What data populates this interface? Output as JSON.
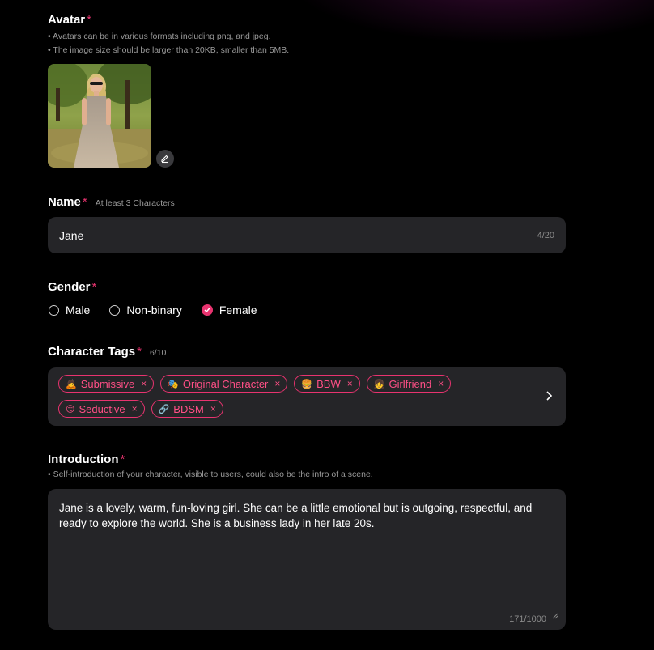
{
  "avatar": {
    "title": "Avatar",
    "required_mark": "*",
    "hints": [
      "• Avatars can be in various formats including png, and jpeg.",
      "• The image size should be larger than 20KB, smaller than 5MB."
    ],
    "edit_icon": "edit-icon"
  },
  "name": {
    "title": "Name",
    "required_mark": "*",
    "hint": "At least 3 Characters",
    "value": "Jane",
    "counter": "4/20"
  },
  "gender": {
    "title": "Gender",
    "required_mark": "*",
    "options": [
      {
        "label": "Male",
        "selected": false
      },
      {
        "label": "Non-binary",
        "selected": false
      },
      {
        "label": "Female",
        "selected": true
      }
    ]
  },
  "tags": {
    "title": "Character Tags",
    "required_mark": "*",
    "count": "6/10",
    "items": [
      {
        "emoji": "🙇",
        "label": "Submissive"
      },
      {
        "emoji": "🎭",
        "label": "Original Character"
      },
      {
        "emoji": "🍔",
        "label": "BBW"
      },
      {
        "emoji": "👧",
        "label": "Girlfriend"
      },
      {
        "emoji": "😏",
        "label": "Seductive"
      },
      {
        "emoji": "🔗",
        "label": "BDSM"
      }
    ],
    "remove_glyph": "×"
  },
  "intro": {
    "title": "Introduction",
    "required_mark": "*",
    "hint": "• Self-introduction of your character, visible to users, could also be the intro of a scene.",
    "value": "Jane is a lovely, warm, fun-loving girl. She can be a little emotional but is outgoing, respectful, and ready to explore the world. She is a business lady in her late 20s.",
    "counter": "171/1000"
  },
  "colors": {
    "accent": "#e8336f",
    "field_bg": "#252528",
    "page_bg": "#000000"
  }
}
